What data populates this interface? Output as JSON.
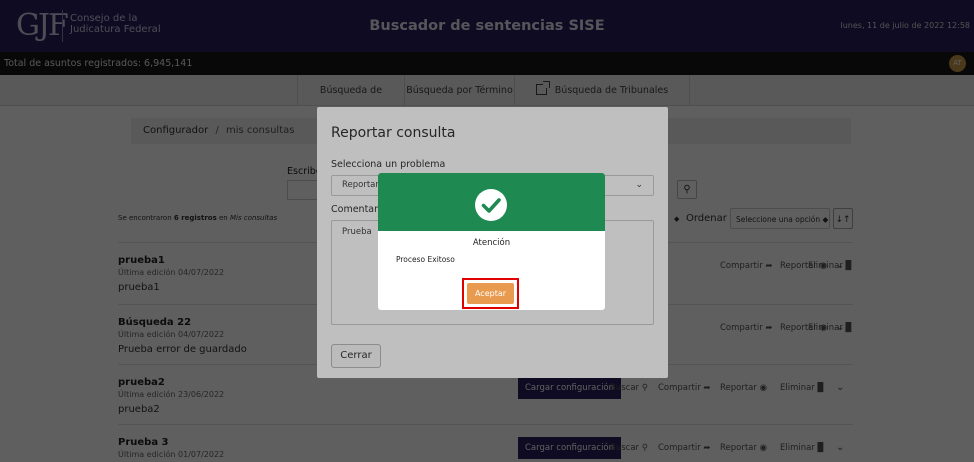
{
  "header": {
    "logo_mark": "GJF",
    "logo_line1": "Consejo de la",
    "logo_line2": "Judicatura Federal",
    "title": "Buscador de sentencias SISE",
    "date": "lunes, 11 de julio de 2022 12:58"
  },
  "subheader": {
    "total": "Total de asuntos registrados: 6,945,141",
    "avatar": "AT"
  },
  "tabs": [
    {
      "label": "Búsqueda de Sentencia"
    },
    {
      "label": "Búsqueda por Término"
    },
    {
      "label": "Búsqueda de Tribunales Laborales"
    }
  ],
  "breadcrumb": {
    "root": "Configurador",
    "sep": "/",
    "current": "mis consultas"
  },
  "search": {
    "label": "Escribe"
  },
  "results": {
    "prefix": "Se encontraron",
    "count": "6 registros",
    "middle": "en",
    "place": "Mis consultas",
    "sort_label": "Ordenar",
    "sort_placeholder": "Seleccione una opción"
  },
  "actions": {
    "load": "Cargar configuración",
    "search": "Buscar",
    "share": "Compartir",
    "report": "Reportar",
    "delete": "Eliminar"
  },
  "rows": [
    {
      "title": "prueba1",
      "date": "Última edición 04/07/2022",
      "desc": "prueba1"
    },
    {
      "title": "Búsqueda 22",
      "date": "Última edición 04/07/2022",
      "desc": "Prueba error de guardado"
    },
    {
      "title": "prueba2",
      "date": "Última edición 23/06/2022",
      "desc": "prueba2"
    },
    {
      "title": "Prueba 3",
      "date": "Última edición 01/07/2022",
      "desc": ""
    }
  ],
  "report_modal": {
    "title": "Reportar consulta",
    "problem_label": "Selecciona un problema",
    "problem_value": "Reportar p",
    "comment_label": "Comentario",
    "comment_value": "Prueba",
    "close": "Cerrar"
  },
  "alert": {
    "title": "Atención",
    "message": "Proceso Exitoso",
    "accept": "Aceptar",
    "header_color": "#1e8a52",
    "button_color": "#e89a4f",
    "icon": "check-circle-icon"
  }
}
